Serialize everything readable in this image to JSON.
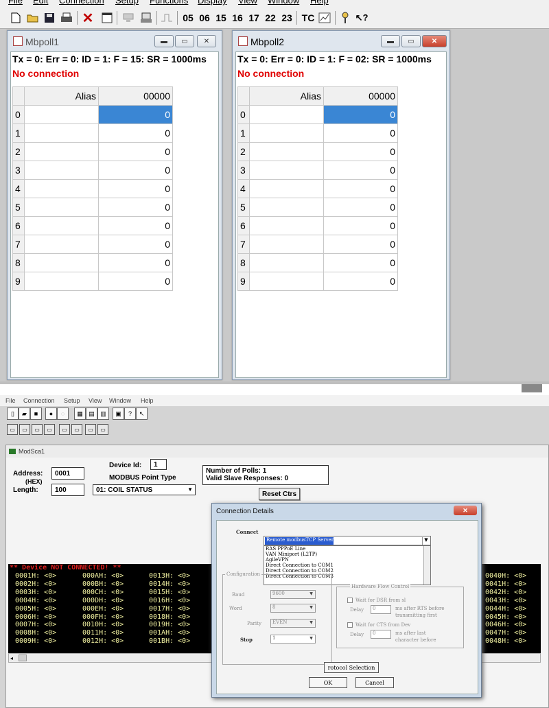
{
  "top_app": {
    "menu": [
      "File",
      "Edit",
      "Connection",
      "Setup",
      "Functions",
      "Display",
      "View",
      "Window",
      "Help"
    ],
    "toolbar": {
      "function_codes": [
        "05",
        "06",
        "15",
        "16",
        "17",
        "22",
        "23"
      ],
      "tc_label": "TC"
    },
    "windows": [
      {
        "title": "Mbpoll1",
        "status": "Tx = 0: Err = 0: ID = 1: F = 15: SR = 1000ms",
        "connection": "No connection",
        "alias_header": "Alias",
        "address_header": "00000",
        "rows": [
          "0",
          "1",
          "2",
          "3",
          "4",
          "5",
          "6",
          "7",
          "8",
          "9"
        ],
        "values": [
          "0",
          "0",
          "0",
          "0",
          "0",
          "0",
          "0",
          "0",
          "0",
          "0"
        ]
      },
      {
        "title": "Mbpoll2",
        "status": "Tx = 0: Err = 0: ID = 1: F = 02: SR = 1000ms",
        "connection": "No connection",
        "alias_header": "Alias",
        "address_header": "00000",
        "rows": [
          "0",
          "1",
          "2",
          "3",
          "4",
          "5",
          "6",
          "7",
          "8",
          "9"
        ],
        "values": [
          "0",
          "0",
          "0",
          "0",
          "0",
          "0",
          "0",
          "0",
          "0",
          "0"
        ]
      }
    ]
  },
  "bottom_app": {
    "menu": [
      "File",
      "Connection",
      "Setup",
      "View",
      "Window",
      "Help"
    ],
    "child_title": "ModSca1",
    "device_id_label": "Device Id:",
    "device_id": "1",
    "point_type_label": "MODBUS Point Type",
    "address_label": "Address:",
    "address": "0001",
    "hex_label": "(HEX)",
    "length_label": "Length:",
    "length": "100",
    "point_type": "01: COIL STATUS",
    "polls": "Number of Polls: 1",
    "responses": "Valid Slave Responses: 0",
    "reset_button": "Reset Ctrs",
    "terminal_error": "** Device NOT CONNECTED! **",
    "terminal_cols": [
      [
        "0001H: <0>",
        "0002H: <0>",
        "0003H: <0>",
        "0004H: <0>",
        "0005H: <0>",
        "0006H: <0>",
        "0007H: <0>",
        "0008H: <0>",
        "0009H: <0>"
      ],
      [
        "000AH: <0>",
        "000BH: <0>",
        "000CH: <0>",
        "000DH: <0>",
        "000EH: <0>",
        "000FH: <0>",
        "0010H: <0>",
        "0011H: <0>",
        "0012H: <0>"
      ],
      [
        "0013H: <0>",
        "0014H: <0>",
        "0015H: <0>",
        "0016H: <0>",
        "0017H: <0>",
        "0018H: <0>",
        "0019H: <0>",
        "001AH: <0>",
        "001BH: <0>"
      ],
      [
        "0040H: <0>",
        "0041H: <0>",
        "0042H: <0>",
        "0043H: <0>",
        "0044H: <0>",
        "0045H: <0>",
        "0046H: <0>",
        "0047H: <0>",
        "0048H: <0>"
      ]
    ]
  },
  "dialog": {
    "title": "Connection Details",
    "connect_label": "Connect",
    "connect_selected": "Remote modbusTCP Server",
    "connect_options": [
      "RAS PPPoE Line",
      "VAN Miniport (L2TP)",
      "AgileVPN",
      "Direct Connection to COM1",
      "Direct Connection to COM2",
      "Direct Connection to COM3"
    ],
    "config_label": "Configuration",
    "baud_label": "Baud",
    "baud_value": "9600",
    "word_label": "Word",
    "word_value": "8",
    "parity_label": "Parity",
    "parity_value": "EVEN",
    "stop_label": "Stop",
    "stop_value": "1",
    "hw_group": "Hardware Flow Control",
    "wait_dsr": "Wait for DSR from sl",
    "delay_label": "Delay",
    "delay1": "0",
    "delay1_text1": "ms after RTS before",
    "delay1_text2": "transmitting first",
    "wait_cts": "Wait for CTS from Dev",
    "delay2": "0",
    "delay2_text1": "ms after last",
    "delay2_text2": "character before",
    "protocol_button": "rotocol Selection",
    "ok_button": "OK",
    "cancel_button": "Cancel"
  }
}
